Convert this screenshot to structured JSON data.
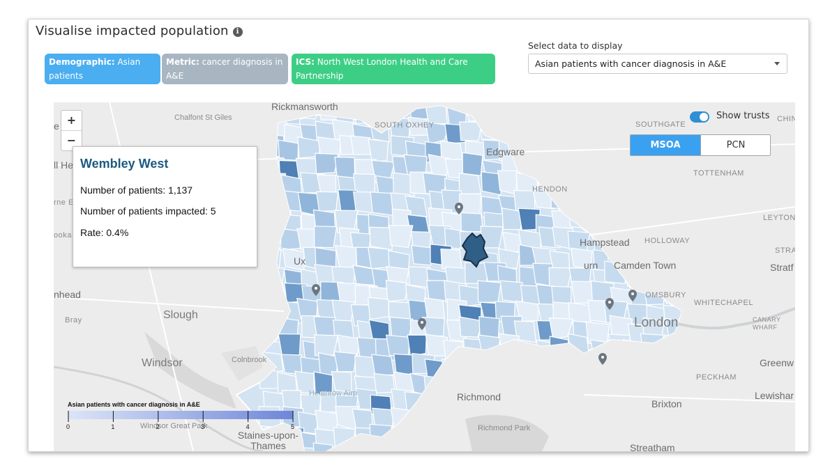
{
  "header": {
    "title": "Visualise impacted population",
    "info_icon": "info-icon"
  },
  "chips": [
    {
      "key": "Demographic:",
      "value": "Asian patients",
      "color": "#4aaef0"
    },
    {
      "key": "Metric:",
      "value": "cancer diagnosis in A&E",
      "color": "#a8b6c2"
    },
    {
      "key": "ICS:",
      "value": "North West London Health and Care Partnership",
      "color": "#3dce86"
    }
  ],
  "data_select": {
    "label": "Select data to display",
    "value": "Asian patients with cancer diagnosis in A&E"
  },
  "map": {
    "zoom_in": "+",
    "zoom_out": "−",
    "show_trusts": {
      "label": "Show trusts",
      "on": true
    },
    "level_toggle": {
      "options": [
        "MSOA",
        "PCN"
      ],
      "selected": "MSOA"
    },
    "tooltip": {
      "area": "Wembley West",
      "patients": "Number of patients: 1,137",
      "impacted": "Number of patients impacted: 5",
      "rate": "Rate: 0.4%"
    },
    "legend": {
      "title": "Asian patients with cancer diagnosis in A&E",
      "ticks": [
        "0",
        "1",
        "2",
        "3",
        "4",
        "5"
      ],
      "color_min": "#dbe5f8",
      "color_max": "#6f86d8"
    },
    "places": {
      "rickmansworth": "Rickmansworth",
      "chalfont": "Chalfont St Giles",
      "south_oxhey": "SOUTH OXHEY",
      "edgware": "Edgware",
      "southgate": "SOUTHGATE",
      "ching": "CHING",
      "hendon": "HENDON",
      "tottenham": "TOTTENHAM",
      "leyton": "LEYTON",
      "hampstead": "Hampstead",
      "holloway": "HOLLOWAY",
      "stratford_caps": "STRATI",
      "stratford": "Stratf",
      "camden": "Camden Town",
      "urn": "urn",
      "uxbridge": "Ux",
      "bloomsbury": "OMSBURY",
      "whitechapel": "WHITECHAPEL",
      "london": "London",
      "canary": "CANARY WHARF",
      "slough": "Slough",
      "bray": "Bray",
      "windsor": "Windsor",
      "colnbrook": "Colnbrook",
      "heathrow": "Heathrow Airp",
      "richmond": "Richmond",
      "richmond_park": "Richmond Park",
      "windsor_great_park": "Windsor Great Park",
      "staines": "Staines-upon-Thames",
      "brixton": "Brixton",
      "peckham": "PECKHAM",
      "greenwich": "Greenw",
      "lewisham": "Lewishar",
      "streatham": "Streatham",
      "ll_he": "ll He",
      "rne_e": "rne E",
      "ooka": "ooka",
      "nhead": "nhead",
      "e": "e"
    },
    "selected_area_color": "#2f5f87",
    "trust_pin_color": "#6c7680"
  }
}
